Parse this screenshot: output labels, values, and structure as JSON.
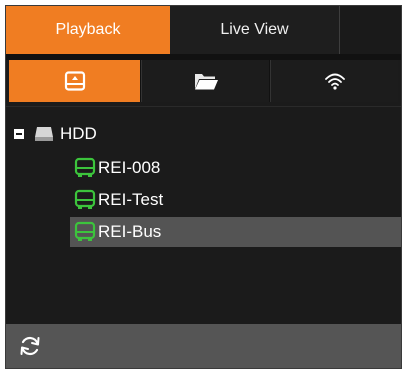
{
  "tabs": {
    "playback": "Playback",
    "live_view": "Live View"
  },
  "source_buttons": [
    {
      "icon": "hdd-icon",
      "active": true
    },
    {
      "icon": "folder-icon",
      "active": false
    },
    {
      "icon": "wifi-icon",
      "active": false
    }
  ],
  "tree": {
    "root": {
      "label": "HDD",
      "expanded": true,
      "icon": "drive-icon"
    },
    "devices": [
      {
        "label": "REI-008",
        "icon": "bus-icon",
        "selected": false
      },
      {
        "label": "REI-Test",
        "icon": "bus-icon",
        "selected": false
      },
      {
        "label": "REI-Bus",
        "icon": "bus-icon",
        "selected": true
      }
    ]
  },
  "bottom_bar": {
    "refresh_icon": "refresh-icon"
  },
  "colors": {
    "accent": "#f07d22",
    "bus_icon": "#3cc43c",
    "selected_row": "#545454",
    "background": "#1b1b1b",
    "bottom_bar": "#555555"
  }
}
